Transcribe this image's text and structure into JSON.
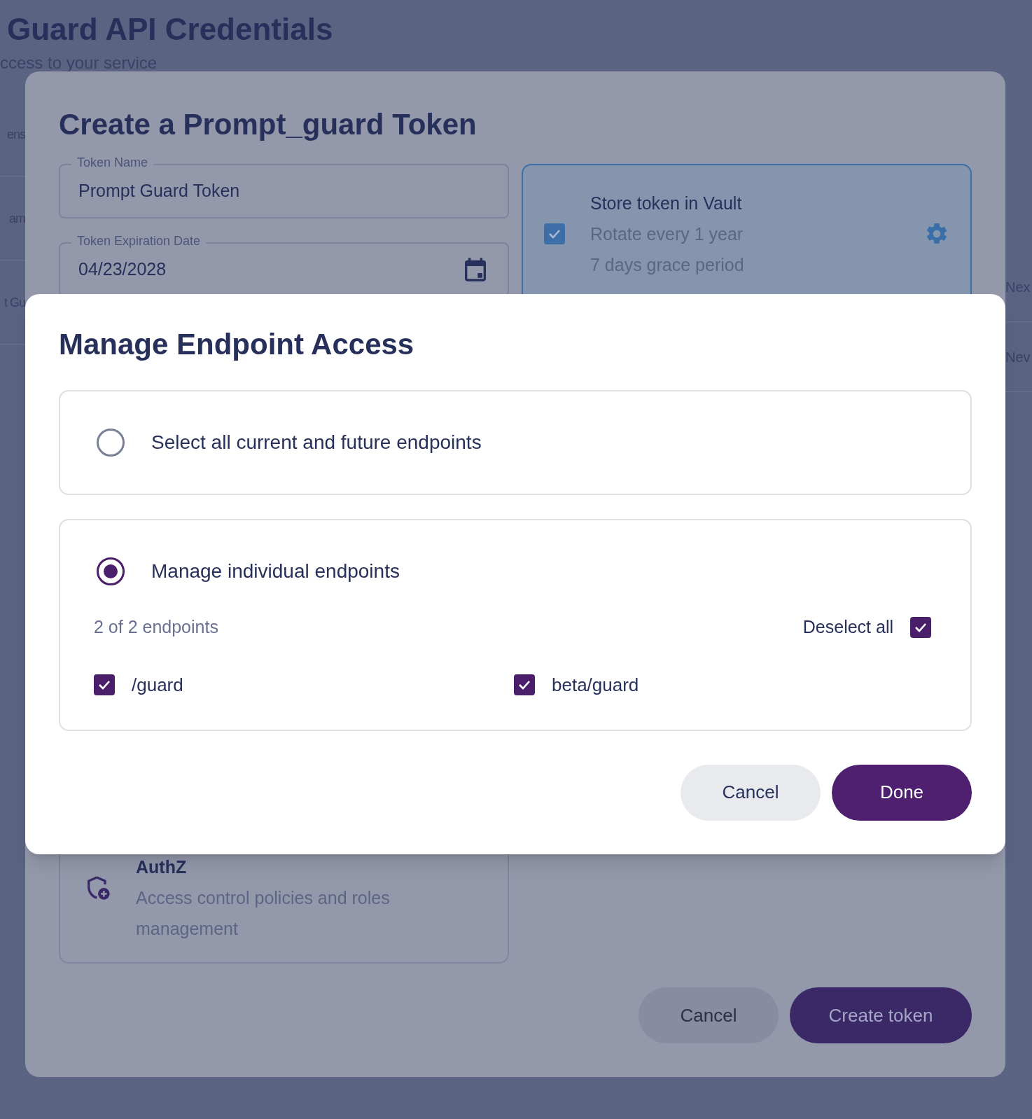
{
  "background": {
    "title": "Guard API Credentials",
    "subtitle": "ccess to your service",
    "left_fragments": [
      "ens",
      "am",
      "t Gu"
    ],
    "right_fragments": [
      "Nex",
      "Nev"
    ]
  },
  "create_dialog": {
    "title": "Create a Prompt_guard Token",
    "fields": [
      {
        "kind": "text",
        "label": "Token Name",
        "value": "Prompt Guard Token"
      },
      {
        "kind": "date",
        "label": "Token Expiration Date",
        "value": "04/23/2028"
      }
    ],
    "vault": {
      "checked": true,
      "title": "Store token in Vault",
      "lines": [
        "Rotate every 1 year",
        "7 days grace period"
      ]
    },
    "authz": {
      "title": "AuthZ",
      "description": "Access control policies and roles management"
    },
    "buttons": [
      {
        "kind": "secondary",
        "label": "Cancel"
      },
      {
        "kind": "primary",
        "label": "Create token"
      }
    ]
  },
  "endpoint_dialog": {
    "title": "Manage Endpoint Access",
    "options": [
      {
        "label": "Select all current and future endpoints",
        "selected": false
      },
      {
        "label": "Manage individual endpoints",
        "selected": true,
        "count": "2 of 2 endpoints",
        "deselect": {
          "label": "Deselect all",
          "checked": true
        },
        "endpoints": [
          {
            "path": "/guard",
            "checked": true
          },
          {
            "path": "beta/guard",
            "checked": true
          }
        ]
      }
    ],
    "buttons": [
      {
        "kind": "secondary",
        "label": "Cancel"
      },
      {
        "kind": "primary",
        "label": "Done"
      }
    ]
  }
}
